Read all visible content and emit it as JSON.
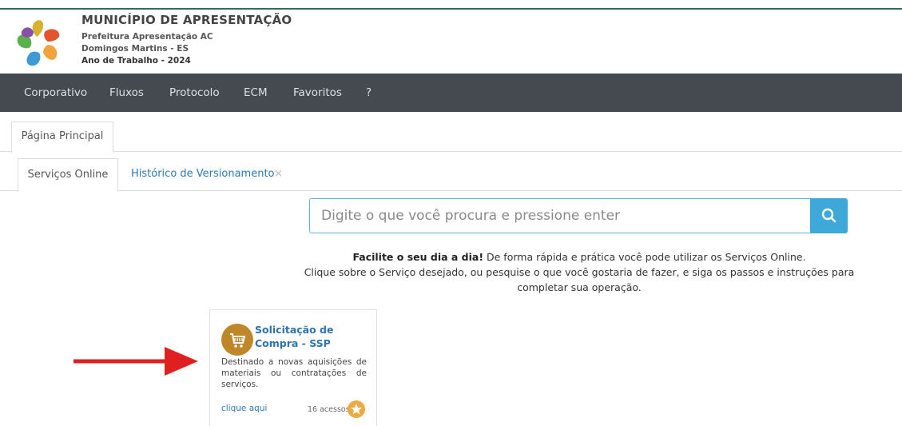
{
  "header": {
    "title": "MUNICÍPIO DE APRESENTAÇÃO",
    "line1": "Prefeitura Apresentação AC",
    "line2": "Domingos Martins - ES",
    "line3": "Ano de Trabalho - 2024"
  },
  "nav": {
    "items": [
      "Corporativo",
      "Fluxos",
      "Protocolo",
      "ECM",
      "Favoritos",
      "?"
    ]
  },
  "tabs_main": {
    "home": "Página Principal"
  },
  "tabs_sub": {
    "services": "Serviços Online",
    "history": "Histórico de Versionamento",
    "close": "×"
  },
  "search": {
    "placeholder": "Digite o que você procura e pressione enter",
    "icon": "search-icon"
  },
  "intro": {
    "bold": "Facilite o seu dia a dia!",
    "rest1": " De forma rápida e prática você pode utilizar os Serviços Online.",
    "line2": "Clique sobre o Serviço desejado, ou pesquise o que você gostaria de fazer, e siga os passos e instruções para completar sua operação."
  },
  "card": {
    "icon": "shopping-cart-icon",
    "title": "Solicitação de Compra - SSP",
    "description": "Destinado a novas aquisições de materiais ou contratações de serviços.",
    "link": "clique aqui",
    "count": "16 acessos",
    "star_icon": "star-icon"
  },
  "colors": {
    "navbar": "#454a51",
    "accent": "#3ea9d8",
    "card_icon": "#c0872a",
    "star": "#f0a93e",
    "arrow": "#e02020"
  }
}
